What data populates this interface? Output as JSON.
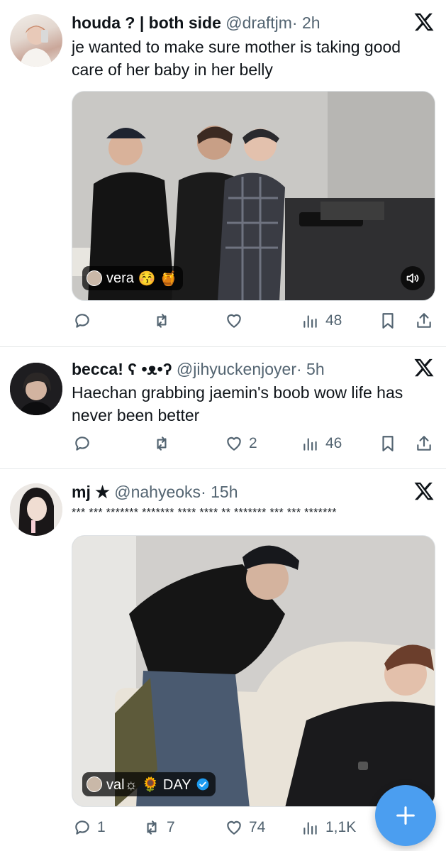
{
  "tweets": [
    {
      "name": "houda ? | both side",
      "handle": "@draftjm",
      "time": "· 2h",
      "text": "je wanted to make sure mother is taking good care of her baby in her belly",
      "media": {
        "chip_label": "vera",
        "chip_emoji": "😚 🍯"
      },
      "actions": {
        "reply": "",
        "retweet": "",
        "like": "",
        "views": "48"
      }
    },
    {
      "name": "becca! ʕ •ᴥ•ʔ",
      "handle": "@jihyuckenjoyer",
      "time": "· 5h",
      "text": "Haechan grabbing jaemin's boob wow life has never been better",
      "actions": {
        "reply": "",
        "retweet": "",
        "like": "2",
        "views": "46"
      }
    },
    {
      "name": "mj ★",
      "handle": "@nahyeoks",
      "time": "· 15h",
      "text": "*** *** ******* ******* **** **** ** ******* *** *** *******",
      "media": {
        "chip_label": "val☼ 🌻 DAY"
      },
      "actions": {
        "reply": "1",
        "retweet": "7",
        "like": "74",
        "views": "1,1K"
      }
    }
  ],
  "colors": {
    "accent": "#1d9bf0",
    "fab": "#4b9ef0",
    "muted": "#536471"
  }
}
